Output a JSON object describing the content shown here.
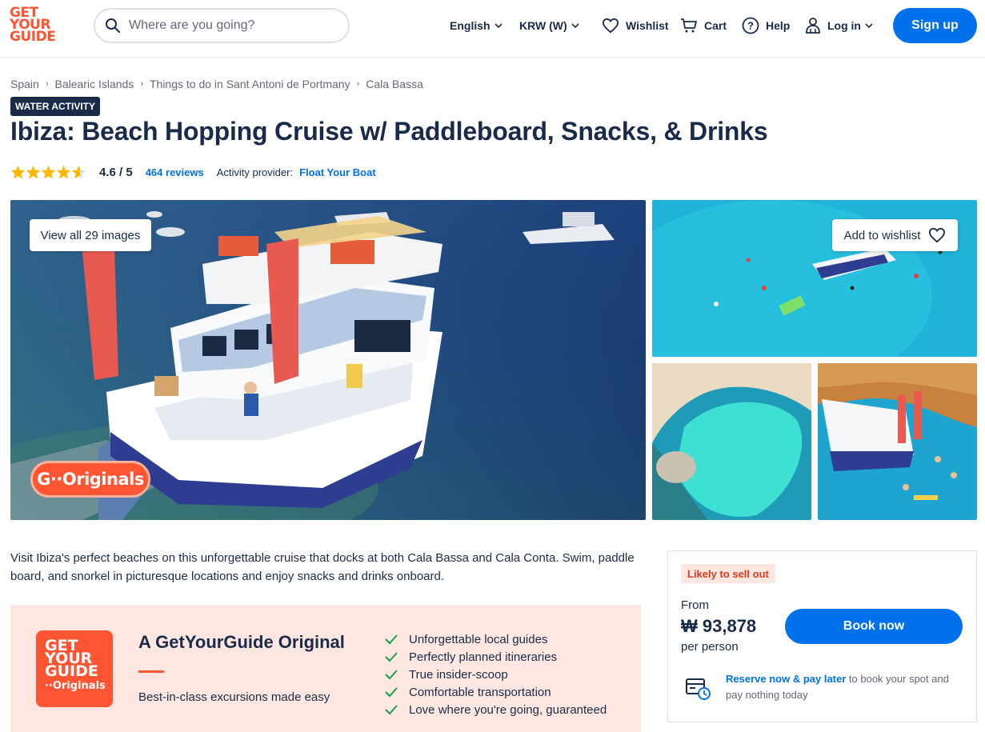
{
  "header": {
    "logo": [
      "GET",
      "YOUR",
      "GUIDE"
    ],
    "search_placeholder": "Where are you going?",
    "language": "English",
    "currency": "KRW (W)",
    "wishlist": "Wishlist",
    "cart": "Cart",
    "help": "Help",
    "login": "Log in",
    "signup": "Sign up"
  },
  "breadcrumb": [
    "Spain",
    "Balearic Islands",
    "Things to do in Sant Antoni de Portmany",
    "Cala Bassa"
  ],
  "badge": "WATER ACTIVITY",
  "title": "Ibiza: Beach Hopping Cruise w/ Paddleboard, Snacks, & Drinks",
  "rating": {
    "stars": 4.6,
    "value": "4.6 / 5",
    "reviews": "464 reviews",
    "provider_label": "Activity provider:",
    "provider": "Float Your Boat"
  },
  "gallery": {
    "view_all": "View all 29 images",
    "add_to_wishlist": "Add to wishlist",
    "originals_badge": "G··Originals"
  },
  "description": "Visit Ibiza's perfect beaches on this unforgettable cruise that docks at both Cala Bassa and Cala Conta. Swim, paddle board, and snorkel in picturesque locations and enjoy snacks and drinks onboard.",
  "originals": {
    "logo_lines": [
      "GET",
      "YOUR",
      "GUIDE"
    ],
    "logo_sub": "··Originals",
    "title": "A GetYourGuide Original",
    "subtitle": "Best-in-class excursions made easy",
    "features": [
      "Unforgettable local guides",
      "Perfectly planned itineraries",
      "True insider-scoop",
      "Comfortable transportation",
      "Love where you're going, guaranteed"
    ]
  },
  "booking": {
    "sellout": "Likely to sell out",
    "from": "From",
    "price": "₩ 93,878",
    "per": "per person",
    "book_now": "Book now",
    "reserve_link": "Reserve now & pay later",
    "reserve_rest": " to book your spot and pay nothing today"
  },
  "colors": {
    "brand_orange": "#ff5533",
    "primary_blue": "#0071eb",
    "navy": "#1a2b49",
    "star": "#ffb800"
  }
}
